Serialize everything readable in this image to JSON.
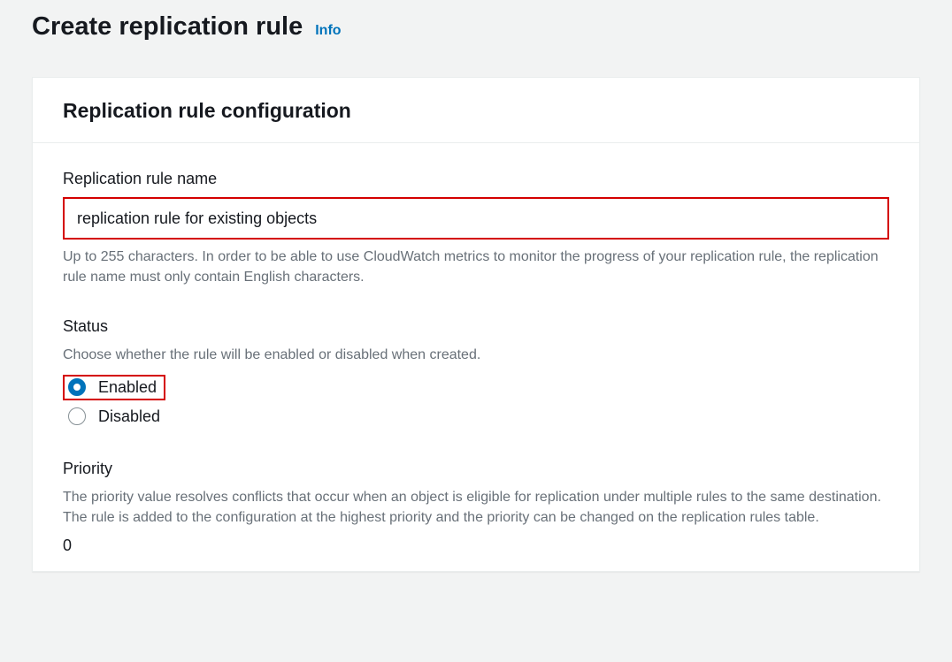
{
  "header": {
    "title": "Create replication rule",
    "info_label": "Info"
  },
  "panel": {
    "title": "Replication rule configuration",
    "rule_name": {
      "label": "Replication rule name",
      "value": "replication rule for existing objects",
      "help": "Up to 255 characters. In order to be able to use CloudWatch metrics to monitor the progress of your replication rule, the replication rule name must only contain English characters."
    },
    "status": {
      "label": "Status",
      "help": "Choose whether the rule will be enabled or disabled when created.",
      "options": {
        "enabled": "Enabled",
        "disabled": "Disabled"
      }
    },
    "priority": {
      "label": "Priority",
      "help": "The priority value resolves conflicts that occur when an object is eligible for replication under multiple rules to the same destination. The rule is added to the configuration at the highest priority and the priority can be changed on the replication rules table.",
      "value": "0"
    }
  }
}
